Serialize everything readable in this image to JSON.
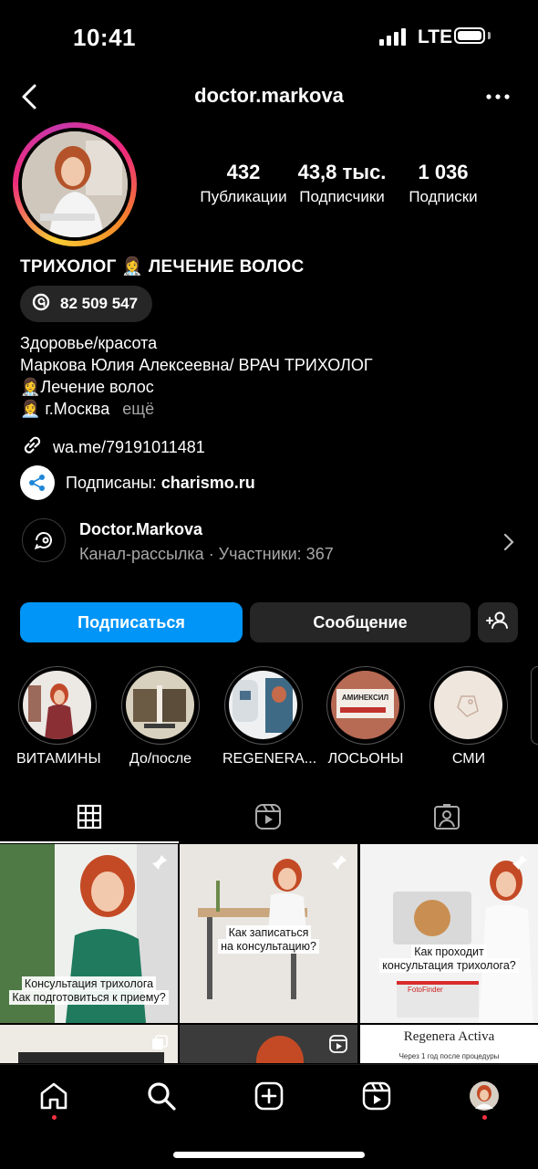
{
  "status_bar": {
    "time": "10:41",
    "network": "LTE"
  },
  "header": {
    "username": "doctor.markova",
    "back_icon": "chevron-left-icon",
    "more_icon": "more-horizontal-icon"
  },
  "profile": {
    "stats": [
      {
        "value": "432",
        "label": "Публикации"
      },
      {
        "value": "43,8 тыс.",
        "label": "Подписчики"
      },
      {
        "value": "1 036",
        "label": "Подписки"
      }
    ],
    "display_name": "ТРИХОЛОГ 👩‍⚕️ ЛЕЧЕНИЕ ВОЛОС",
    "threads_count": "82 509 547",
    "category": "Здоровье/красота",
    "bio_line1": "Маркова Юлия Алексеевна/ ВРАЧ ТРИХОЛОГ",
    "bio_line2": "👩‍⚕️Лечение волос",
    "bio_line3": "👩‍💼 г.Москва",
    "more_label": "ещё",
    "link": "wa.me/79191011481",
    "followed_prefix": "Подписаны: ",
    "followed_name": "charismo.ru"
  },
  "channel": {
    "title": "Doctor.Markova",
    "subtitle": "Канал-рассылка · Участники: 367"
  },
  "buttons": {
    "follow": "Подписаться",
    "message": "Сообщение"
  },
  "highlights": [
    {
      "label": "ВИТАМИНЫ"
    },
    {
      "label": "До/после"
    },
    {
      "label": "REGENERA..."
    },
    {
      "label": "ЛОСЬОНЫ",
      "pic_text": "АМИНЕКСИЛ"
    },
    {
      "label": "СМИ"
    }
  ],
  "tabs": [
    "grid-icon",
    "reels-icon",
    "tagged-icon"
  ],
  "posts": [
    {
      "caption_l1": "Консультация трихолога",
      "caption_l2": "Как подготовиться к приему?"
    },
    {
      "caption_l1": "Как записаться",
      "caption_l2": "на консультацию?"
    },
    {
      "caption_l1": "Как проходит",
      "caption_l2": "консультация трихолога?",
      "brand": "FotoFinder"
    },
    {},
    {},
    {
      "title": "Regenera Activa",
      "sub": "Через 1 год после процедуры"
    }
  ],
  "nav": [
    "home-icon",
    "search-icon",
    "create-icon",
    "reels-icon",
    "profile-avatar"
  ]
}
